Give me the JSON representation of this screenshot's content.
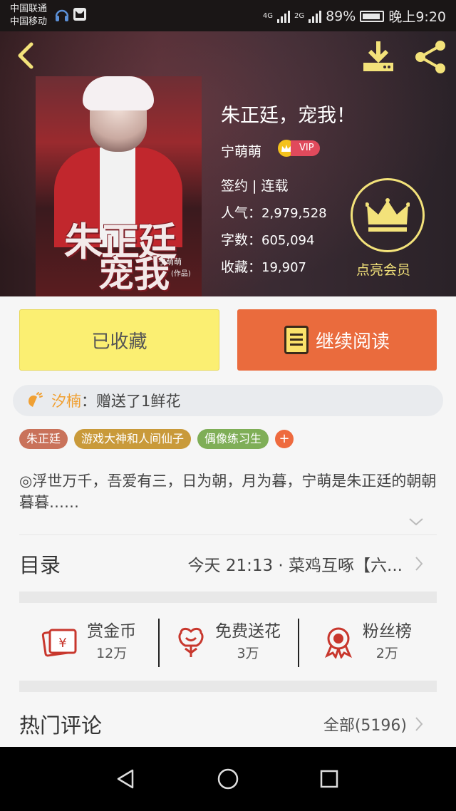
{
  "status_bar": {
    "carrier_1": "中国联通",
    "carrier_2": "中国移动",
    "net_1": "4G",
    "net_2": "2G",
    "battery": "89%",
    "time": "晚上9:20"
  },
  "header": {
    "back_icon": "chevron-left-icon",
    "download_icon": "download-icon",
    "share_icon": "share-icon"
  },
  "book": {
    "title": "朱正廷，宠我！",
    "author": "宁萌萌",
    "vip_label": "VIP",
    "status": "签约 | 连载",
    "popularity_label": "人气：",
    "popularity": "2,979,528",
    "wordcount_label": "字数：",
    "wordcount": "605,094",
    "favorites_label": "收藏：",
    "favorites": "19,907",
    "cover_title_1": "朱正廷",
    "cover_title_2": "宠我",
    "cover_author": "宁萌萌",
    "cover_note": "(作品)"
  },
  "member": {
    "label": "点亮会员",
    "icon": "crown-icon"
  },
  "actions": {
    "collected_label": "已收藏",
    "read_label": "继续阅读"
  },
  "flower_notice": {
    "giver": "汐楠",
    "text": "：赠送了1鲜花"
  },
  "tags": [
    {
      "label": "朱正廷",
      "color": "#c9725a"
    },
    {
      "label": "游戏大神和人间仙子",
      "color": "#c99a3a"
    },
    {
      "label": "偶像练习生",
      "color": "#7fae57"
    }
  ],
  "tag_add": "+",
  "intro": "◎浮世万千，吾爱有三，日为朝，月为暮，宁萌是朱正廷的朝朝暮暮……",
  "toc": {
    "label": "目录",
    "latest": "今天 21:13 · 菜鸡互啄【六..."
  },
  "stats": [
    {
      "name": "赏金币",
      "count": "12万",
      "icon": "reward-coin-icon"
    },
    {
      "name": "免费送花",
      "count": "3万",
      "icon": "flower-icon"
    },
    {
      "name": "粉丝榜",
      "count": "2万",
      "icon": "medal-icon"
    }
  ],
  "comments": {
    "label": "热门评论",
    "all": "全部(5196)"
  },
  "colors": {
    "accent_yellow": "#fbef72",
    "accent_orange": "#ea6b3d",
    "gold": "#f3e27a"
  }
}
